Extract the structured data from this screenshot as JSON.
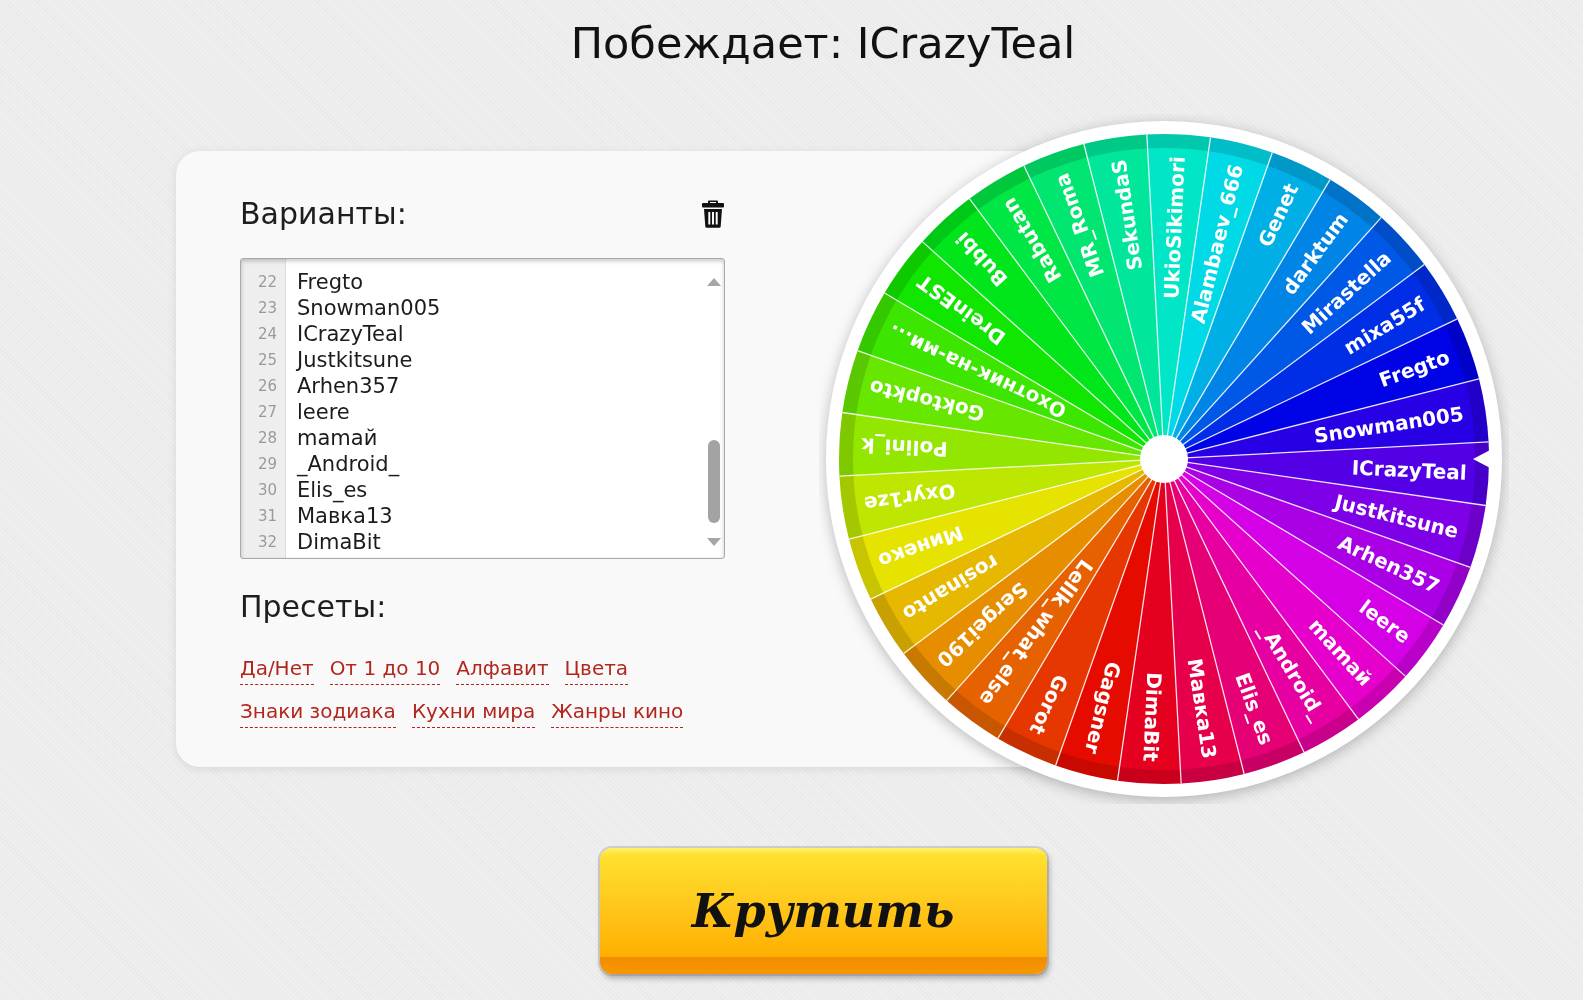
{
  "title": "Побеждает: ICrazyTeal",
  "options_panel": {
    "heading": "Варианты:",
    "editor_lines": [
      {
        "number": "22",
        "text": "Fregto"
      },
      {
        "number": "23",
        "text": "Snowman005"
      },
      {
        "number": "24",
        "text": "ICrazyTeal"
      },
      {
        "number": "25",
        "text": "Justkitsune"
      },
      {
        "number": "26",
        "text": "Arhen357"
      },
      {
        "number": "27",
        "text": "leere"
      },
      {
        "number": "28",
        "text": "mamaй"
      },
      {
        "number": "29",
        "text": "_Android_"
      },
      {
        "number": "30",
        "text": "Elis_es"
      },
      {
        "number": "31",
        "text": "Мавка13"
      },
      {
        "number": "32",
        "text": "DimaBit"
      }
    ],
    "presets_heading": "Пресеты:",
    "presets": [
      "Да/Нет",
      "От 1 до 10",
      "Алфавит",
      "Цвета",
      "Знаки зодиака",
      "Кухни мира",
      "Жанры кино"
    ]
  },
  "wheel": {
    "segments": [
      {
        "label": "Gagsner"
      },
      {
        "label": "Gorot"
      },
      {
        "label": "Lellk_what_else"
      },
      {
        "label": "Sergei190"
      },
      {
        "label": "rosinanto"
      },
      {
        "label": "Минеко"
      },
      {
        "label": "Oxyr1ze"
      },
      {
        "label": "Polini_k"
      },
      {
        "label": "Goktopkto"
      },
      {
        "label": "Охотник-на-ми..."
      },
      {
        "label": "DreinEST"
      },
      {
        "label": "Bubbi"
      },
      {
        "label": "Rabutan"
      },
      {
        "label": "MR_Roma"
      },
      {
        "label": "SekundaS"
      },
      {
        "label": "UkioSikimori"
      },
      {
        "label": "Alambaev_666"
      },
      {
        "label": "Genet"
      },
      {
        "label": "darktum"
      },
      {
        "label": "Mirastella"
      },
      {
        "label": "mixa55f"
      },
      {
        "label": "Fregto"
      },
      {
        "label": "Snowman005"
      },
      {
        "label": "ICrazyTeal"
      },
      {
        "label": "Justkitsune"
      },
      {
        "label": "Arhen357"
      },
      {
        "label": "leere"
      },
      {
        "label": "mamaй"
      },
      {
        "label": "_Android_"
      },
      {
        "label": "Elis_es"
      },
      {
        "label": "Мавка13"
      },
      {
        "label": "DimaBit"
      }
    ]
  },
  "spin_button": "Крутить"
}
